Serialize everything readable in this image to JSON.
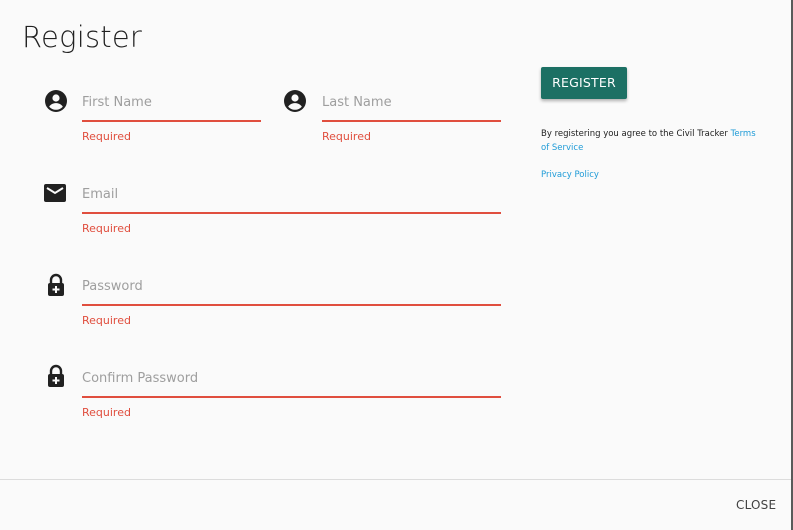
{
  "dialog": {
    "title": "Register",
    "fields": [
      {
        "name": "first-name",
        "placeholder": "First Name",
        "error": "Required",
        "icon": "account-circle-icon"
      },
      {
        "name": "last-name",
        "placeholder": "Last Name",
        "error": "Required",
        "icon": "account-circle-icon"
      },
      {
        "name": "email",
        "placeholder": "Email",
        "error": "Required",
        "icon": "email-icon"
      },
      {
        "name": "password",
        "placeholder": "Password",
        "error": "Required",
        "icon": "lock-plus-icon"
      },
      {
        "name": "confirm-password",
        "placeholder": "Confirm Password",
        "error": "Required",
        "icon": "lock-plus-icon"
      }
    ],
    "register_label": "REGISTER",
    "terms_text": "By registering you agree to the Civil Tracker ",
    "terms_link": "Terms of Service",
    "privacy_link": "Privacy Policy",
    "close_label": "CLOSE"
  },
  "colors": {
    "accent": "#1c7064",
    "error": "#e04e3e",
    "link": "#1e9bd7"
  }
}
